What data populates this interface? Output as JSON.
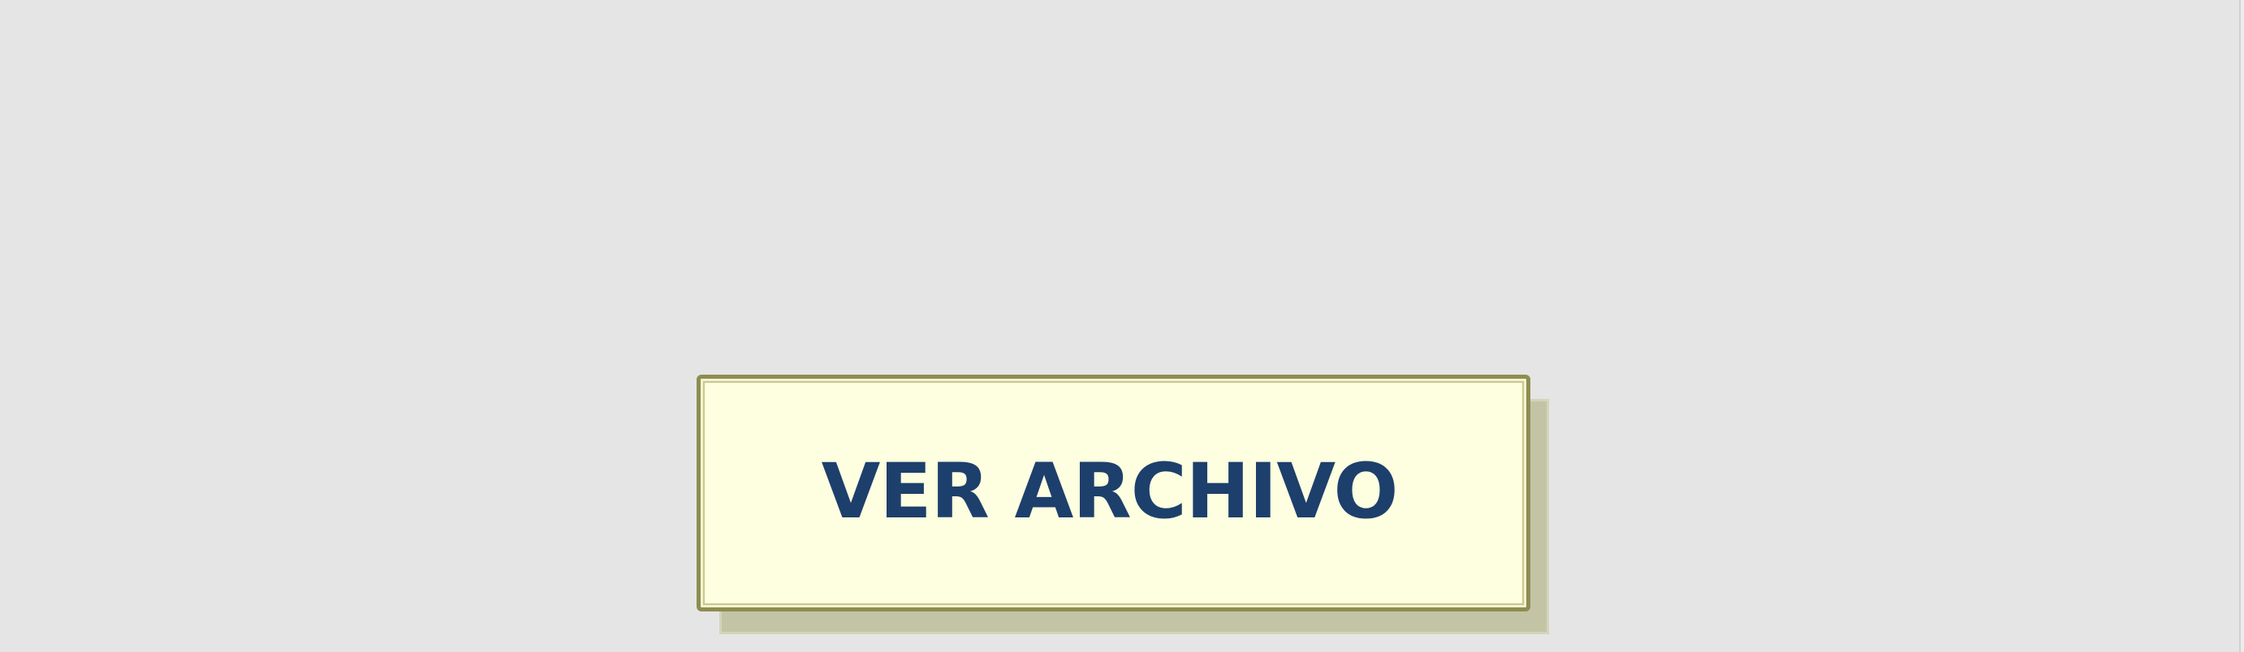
{
  "button": {
    "label": "VER ARCHIVO"
  },
  "colors": {
    "background": "#e5e5e5",
    "button_face": "#fefee0",
    "button_border": "#8e8d52",
    "button_shadow": "#c3c4a5",
    "label": "#1d3f6c"
  }
}
